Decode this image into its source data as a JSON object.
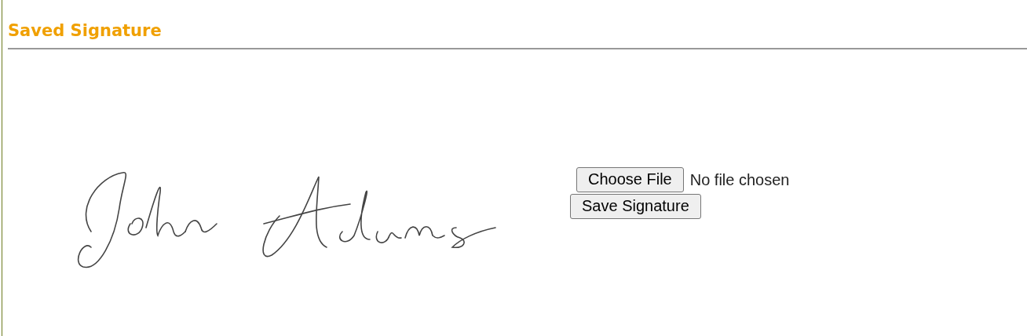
{
  "heading": "Saved Signature",
  "file_input": {
    "button": "Choose File",
    "status": "No file chosen"
  },
  "buttons": [
    "Save Signature"
  ]
}
